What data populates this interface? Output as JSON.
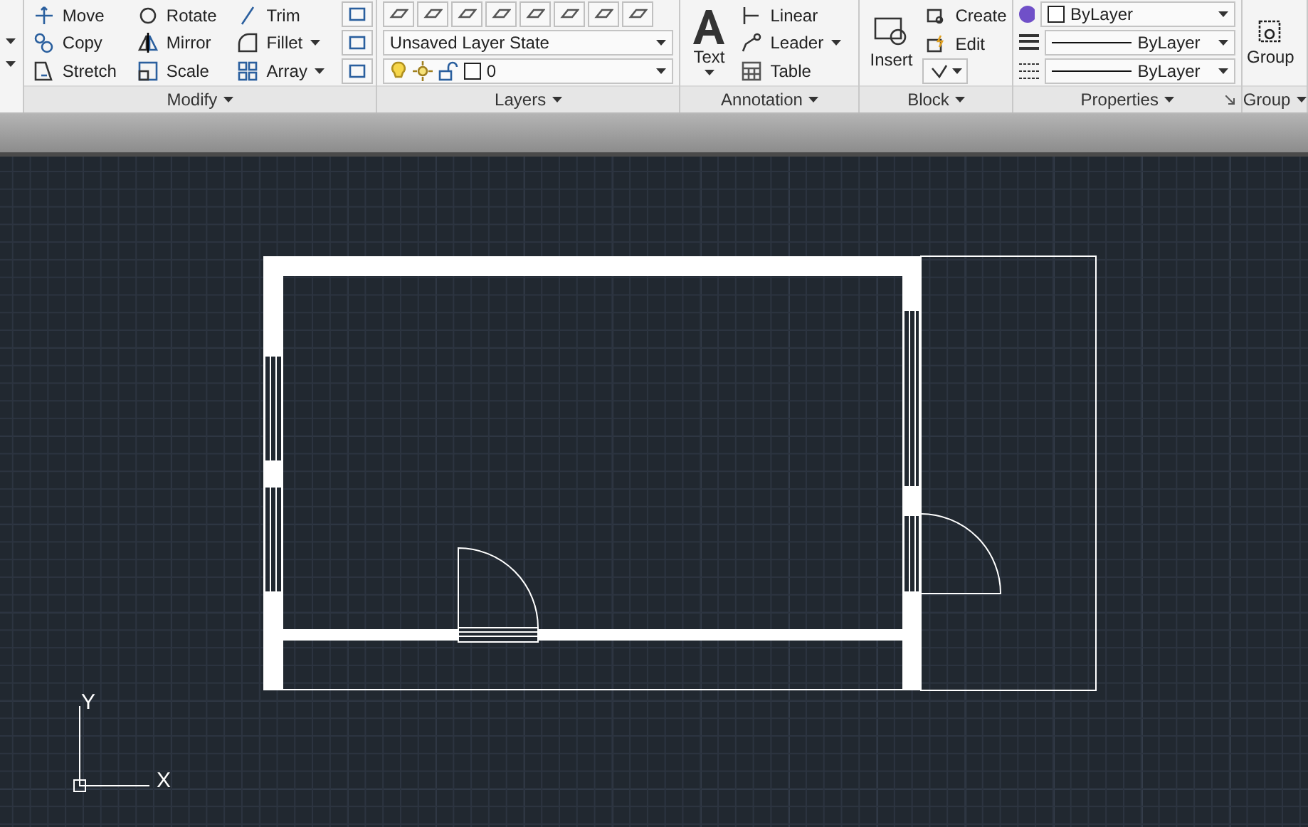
{
  "ribbon": {
    "panels": [
      {
        "kind": "modify",
        "title": "Modify",
        "tools": [
          {
            "label": "Move",
            "has_menu": false
          },
          {
            "label": "Copy",
            "has_menu": false
          },
          {
            "label": "Stretch",
            "has_menu": false
          },
          {
            "label": "Rotate",
            "has_menu": false
          },
          {
            "label": "Mirror",
            "has_menu": false
          },
          {
            "label": "Scale",
            "has_menu": false
          },
          {
            "label": "Trim",
            "has_menu": false
          },
          {
            "label": "Fillet",
            "has_menu": true
          },
          {
            "label": "Array",
            "has_menu": true
          }
        ]
      },
      {
        "kind": "layers",
        "title": "Layers",
        "layer_state": "Unsaved Layer State",
        "current_layer": "0"
      },
      {
        "kind": "annotation",
        "title": "Annotation",
        "big_tool": "Text",
        "tools": [
          {
            "label": "Linear",
            "has_menu": false
          },
          {
            "label": "Leader",
            "has_menu": true
          },
          {
            "label": "Table",
            "has_menu": false
          }
        ]
      },
      {
        "kind": "block",
        "title": "Block",
        "big_tool": "Insert",
        "tools": [
          {
            "label": "Create",
            "has_menu": false
          },
          {
            "label": "Edit",
            "has_menu": false
          }
        ]
      },
      {
        "kind": "properties",
        "title": "Properties",
        "rows": [
          {
            "value": "ByLayer",
            "kind": "color"
          },
          {
            "value": "ByLayer",
            "kind": "lineweight"
          },
          {
            "value": "ByLayer",
            "kind": "linetype"
          }
        ]
      },
      {
        "kind": "group",
        "title": "Group",
        "big_tool": "Group"
      }
    ]
  },
  "canvas": {
    "ucs": {
      "x_label": "X",
      "y_label": "Y"
    }
  }
}
